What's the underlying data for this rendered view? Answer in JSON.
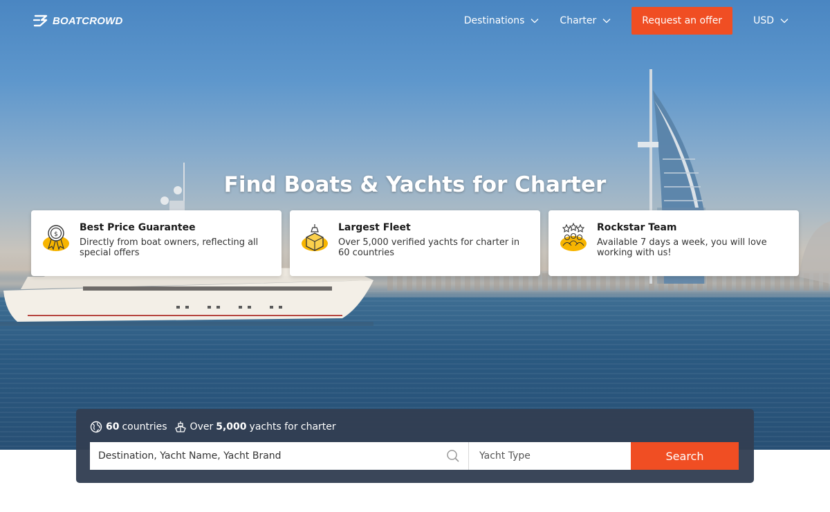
{
  "brand": {
    "name": "BOATCROWD"
  },
  "nav": {
    "items": [
      {
        "label": "Destinations"
      },
      {
        "label": "Charter"
      }
    ],
    "cta_label": "Request an offer",
    "currency": "USD"
  },
  "hero": {
    "title": "Find Boats & Yachts for Charter"
  },
  "features": [
    {
      "title": "Best Price Guarantee",
      "description": "Directly from boat owners, reflecting all special offers",
      "icon": "price-badge-icon"
    },
    {
      "title": "Largest Fleet",
      "description": "Over 5,000 verified yachts for charter in 60 countries",
      "icon": "fleet-box-icon"
    },
    {
      "title": "Rockstar Team",
      "description": "Available 7 days a week, you will love working with us!",
      "icon": "team-stars-icon"
    }
  ],
  "search": {
    "stats": {
      "countries_count": "60",
      "countries_label": "countries",
      "yachts_prefix": "Over",
      "yachts_count": "5,000",
      "yachts_label": "yachts for charter"
    },
    "destination_placeholder": "Destination, Yacht Name, Yacht Brand",
    "yacht_type_placeholder": "Yacht Type",
    "button_label": "Search"
  },
  "colors": {
    "accent": "#f04e23",
    "panel": "#323e52",
    "icon_yellow": "#f7b500"
  }
}
